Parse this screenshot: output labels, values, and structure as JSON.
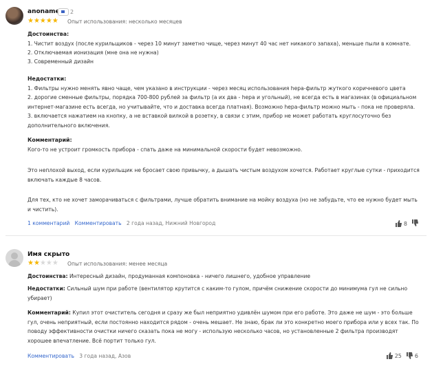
{
  "review1": {
    "author": "anoname",
    "badge_count": "2",
    "rating": 5,
    "experience": "Опыт использования: несколько месяцев",
    "pros_title": "Достоинства:",
    "pros": [
      "1. Чистит воздух (после курильщиков - через 10 минут заметно чище, через минут 40 час нет никакого запаха), меньше пыли в комнате.",
      "2. Отключаемая ионизация (мне она не нужна)",
      "3. Современный дизайн"
    ],
    "cons_title": "Недостатки:",
    "cons": [
      "1. Фильтры нужно менять явно чаще, чем указано в инструкции - через месяц использования hepa-фильтр жуткого коричневого цвета",
      "2. дорогие сменные фильтры, порядка 700-800 рублей за фильтр (а их два - hepa и угольный), не всегда есть в магазинах (в официальном интернет-магазине есть всегда, но учитывайте, что и доставка всегда платная). Возможно hepa-фильтр можно мыть - пока не проверяла.",
      "3. включается нажатием на кнопку, а не вставкой вилкой в розетку, в связи с этим, прибор не может работать круглосуточно без дополнительного включения."
    ],
    "comment_title": "Комментарий:",
    "comment": [
      "Кого-то не устроит громкость прибора - спать даже на минимальной скорости будет невозможно.",
      "Это неплохой выход, если курильщик не бросает свою привычку, а дышать чистым воздухом хочется. Работает круглые сутки - приходится включать каждые 8 часов.",
      "Для тех, кто не хочет заморачиваться с фильтрами, лучше обратить внимание на мойку воздуха (но не забудьте, что ее нужно будет мыть и чистить)."
    ],
    "comments_link": "1 комментарий",
    "reply_link": "Комментировать",
    "meta": "2 года назад, Нижний Новгород",
    "likes": "8"
  },
  "review2": {
    "author": "Имя скрыто",
    "rating": 2,
    "experience": "Опыт использования: менее месяца",
    "pros_label": "Достоинства:",
    "pros": "Интересный дизайн, продуманная компоновка - ничего лишнего, удобное управление",
    "cons_label": "Недостатки:",
    "cons": "Сильный шум при работе (вентилятор крутится с каким-то гулом, причём снижение скорости до минимума гул не сильно убирает)",
    "comment_label": "Комментарий:",
    "comment": "Купил этот очиститель сегодня и сразу же был неприятно удивлён шумом при его работе. Это даже не шум - это больше гул, очень неприятный, если постоянно находится рядом - очень мешает. Не знаю, брак ли это конкретно моего прибора или у всех так. По поводу эффективности очистки ничего сказать пока не могу - использую несколько часов, но установленные 2 фильтра производят хорошее впечатление. Всё портит только гул.",
    "reply_link": "Комментировать",
    "meta": "3 года назад, Азов",
    "likes": "25",
    "dislikes": "6"
  }
}
